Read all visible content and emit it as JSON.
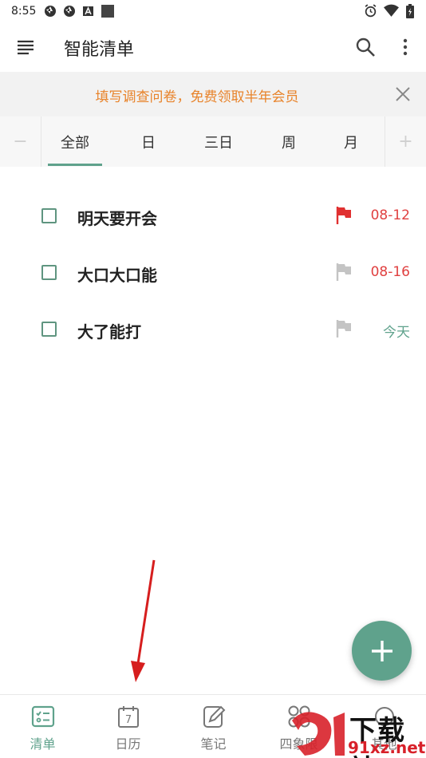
{
  "status_bar": {
    "time": "8:55",
    "icons_left": [
      "aperture-icon",
      "aperture-icon",
      "a-badge-icon",
      "square-icon"
    ],
    "icons_right": [
      "alarm-icon",
      "wifi-icon",
      "battery-charging-icon"
    ]
  },
  "app_bar": {
    "title": "智能清单",
    "menu_icon": "menu-icon",
    "search_icon": "search-icon",
    "more_icon": "more-vertical-icon"
  },
  "banner": {
    "text": "填写调查问卷，免费领取半年会员",
    "close_icon": "close-icon",
    "text_color": "#e8832a"
  },
  "tabs": {
    "minus": "−",
    "plus": "+",
    "items": [
      {
        "label": "全部",
        "active": true
      },
      {
        "label": "日",
        "active": false
      },
      {
        "label": "三日",
        "active": false
      },
      {
        "label": "周",
        "active": false
      },
      {
        "label": "月",
        "active": false
      }
    ]
  },
  "tasks": [
    {
      "title": "明天要开会",
      "flag": "red",
      "date": "08-12",
      "date_color": "#e04040"
    },
    {
      "title": "大口大口能",
      "flag": "gray",
      "date": "08-16",
      "date_color": "#e04040"
    },
    {
      "title": "大了能打",
      "flag": "gray",
      "date": "今天",
      "date_color": "#5fa28c"
    }
  ],
  "fab": {
    "icon": "plus-icon"
  },
  "bottom_nav": [
    {
      "label": "清单",
      "icon": "checklist-icon",
      "active": true
    },
    {
      "label": "日历",
      "icon": "calendar-icon",
      "active": false,
      "icon_text": "7"
    },
    {
      "label": "笔记",
      "icon": "note-edit-icon",
      "active": false
    },
    {
      "label": "四象限",
      "icon": "quadrant-icon",
      "active": false
    },
    {
      "label": "其他",
      "icon": "other-icon",
      "active": false
    }
  ],
  "colors": {
    "accent": "#5fa28c",
    "flag_red": "#e03030",
    "flag_gray": "#c4c4c4"
  },
  "watermark": {
    "line1": "下载站",
    "line2": "91xz.net"
  }
}
